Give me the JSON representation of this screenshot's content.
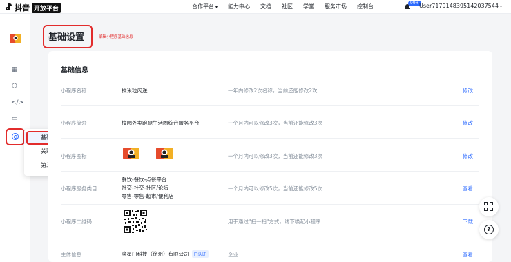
{
  "topbar": {
    "brand": "抖音",
    "brand_badge": "开放平台",
    "nav": [
      "合作平台",
      "能力中心",
      "文档",
      "社区",
      "学堂",
      "服务市场",
      "控制台"
    ],
    "notification_count": "99+",
    "user": "User7179148395142037544"
  },
  "popup_menu": {
    "items": [
      "基础设置",
      "关联设置",
      "第三方设置"
    ]
  },
  "page": {
    "title": "基础设置",
    "subtitle": "编辑小程序基础信息",
    "section_title": "基础信息"
  },
  "rows": [
    {
      "label": "小程序名称",
      "value": "校米粒闪送",
      "hint": "一年内修改2次名称，当前还能修改2次",
      "action": "修改"
    },
    {
      "label": "小程序简介",
      "value": "校园外卖跑腿生活圈综合服务平台",
      "hint": "一个月内可以修改3次，当前还能修改3次",
      "action": "修改"
    },
    {
      "label": "小程序图标",
      "hint": "一个月内可以修改3次，当前还能修改3次",
      "action": "修改"
    },
    {
      "label": "小程序服务类目",
      "categories": [
        "餐饮-餐饮-点餐平台",
        "社交-社交-社区/论坛",
        "零售-零售-超市/便利店"
      ],
      "hint": "一个月内可以修改5次，当前还能修改5次",
      "action": "查看"
    },
    {
      "label": "小程序二维码",
      "hint": "用于通过\"扫一扫\"方式，线下唤起小程序",
      "action": "下载"
    },
    {
      "label": "主体信息",
      "value": "隐星门科技（徐州）有限公司",
      "verified": "已认证",
      "hint": "企业",
      "action": "查看"
    }
  ]
}
